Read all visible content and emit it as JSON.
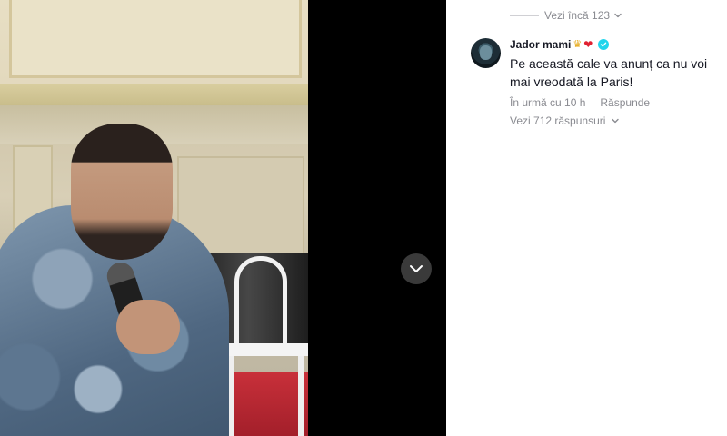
{
  "comments": {
    "view_more_label": "Vezi încă 123",
    "items": [
      {
        "username": "Jador mami",
        "badge_icons": [
          "crown-icon",
          "heart-icon",
          "verified-icon"
        ],
        "text": "Pe această cale va anunț ca nu voi mai vreodată la Paris!",
        "time": "În urmă cu 10 h",
        "reply_label": "Răspunde",
        "view_replies_label": "Vezi 712 răspunsuri"
      }
    ]
  },
  "video": {
    "collapse_icon": "chevron-down-icon"
  },
  "colors": {
    "text_primary": "#161823",
    "text_secondary": "#8a8b91",
    "verified": "#20d5ec",
    "heart": "#e02131",
    "crown": "#e6a817"
  }
}
